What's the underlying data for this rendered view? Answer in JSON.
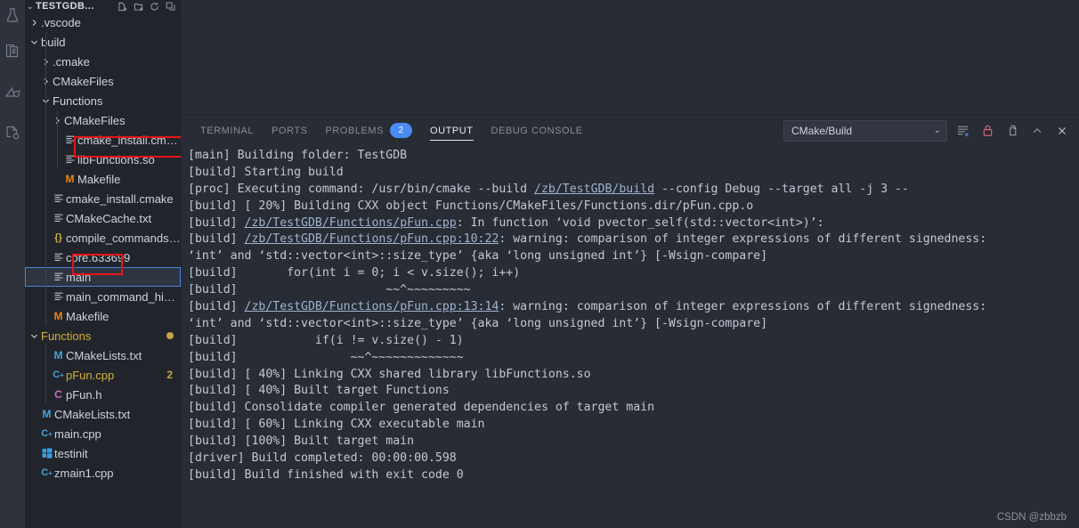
{
  "window": {
    "background": "#282c34",
    "sidebar_background": "#21252b",
    "accent": "#4b8bf5",
    "annotation_color": "#e81416"
  },
  "activity_bar": {
    "items": [
      {
        "name": "testing-beaker-icon"
      },
      {
        "name": "docs-notebook-icon"
      },
      {
        "name": "cmake-tools-icon"
      },
      {
        "name": "cpp-settings-icon"
      }
    ]
  },
  "explorer": {
    "root_label": "TESTGDB...",
    "chevron": "⌄",
    "actions": [
      {
        "name": "new-file-icon",
        "glyph": "⧉"
      },
      {
        "name": "new-folder-icon",
        "glyph": "⧉"
      },
      {
        "name": "refresh-icon",
        "glyph": "⟳"
      },
      {
        "name": "collapse-all-icon",
        "glyph": "⬚"
      }
    ],
    "tree": [
      {
        "label": ".vscode",
        "indent": 1,
        "twisty": "collapsed",
        "icon": "folder",
        "icon_color": "#c3c9d4"
      },
      {
        "label": "build",
        "indent": 1,
        "twisty": "expanded",
        "icon": "folder",
        "icon_color": "#c3c9d4"
      },
      {
        "label": ".cmake",
        "indent": 2,
        "twisty": "collapsed",
        "icon": "folder",
        "icon_color": "#c3c9d4"
      },
      {
        "label": "CMakeFiles",
        "indent": 2,
        "twisty": "collapsed",
        "icon": "folder",
        "icon_color": "#c3c9d4"
      },
      {
        "label": "Functions",
        "indent": 2,
        "twisty": "expanded",
        "icon": "folder",
        "icon_color": "#c3c9d4"
      },
      {
        "label": "CMakeFiles",
        "indent": 3,
        "twisty": "collapsed",
        "icon": "folder",
        "icon_color": "#c3c9d4"
      },
      {
        "label": "cmake_install.cmake",
        "indent": 3,
        "twisty": "none",
        "icon": "lines",
        "icon_color": "#b6bdc9"
      },
      {
        "label": "libFunctions.so",
        "indent": 3,
        "twisty": "none",
        "icon": "lines",
        "icon_color": "#b6bdc9",
        "annotated": true
      },
      {
        "label": "Makefile",
        "indent": 3,
        "twisty": "none",
        "icon": "M",
        "icon_color": "#e8821f"
      },
      {
        "label": "cmake_install.cmake",
        "indent": 2,
        "twisty": "none",
        "icon": "lines",
        "icon_color": "#b6bdc9"
      },
      {
        "label": "CMakeCache.txt",
        "indent": 2,
        "twisty": "none",
        "icon": "lines",
        "icon_color": "#b6bdc9"
      },
      {
        "label": "compile_commands.j...",
        "indent": 2,
        "twisty": "none",
        "icon": "{}",
        "icon_color": "#d3b03a"
      },
      {
        "label": "core.633699",
        "indent": 2,
        "twisty": "none",
        "icon": "lines",
        "icon_color": "#b6bdc9"
      },
      {
        "label": "main",
        "indent": 2,
        "twisty": "none",
        "icon": "lines",
        "icon_color": "#b6bdc9",
        "selected": true,
        "focused": true,
        "annotated": true
      },
      {
        "label": "main_command_hist...",
        "indent": 2,
        "twisty": "none",
        "icon": "lines",
        "icon_color": "#b6bdc9"
      },
      {
        "label": "Makefile",
        "indent": 2,
        "twisty": "none",
        "icon": "M",
        "icon_color": "#e8821f"
      },
      {
        "label": "Functions",
        "indent": 1,
        "twisty": "expanded",
        "icon": "folder",
        "icon_color": "#d3b03a",
        "label_color": "#d3b03a",
        "dot": true
      },
      {
        "label": "CMakeLists.txt",
        "indent": 2,
        "twisty": "none",
        "icon": "M",
        "icon_color": "#48a0d8"
      },
      {
        "label": "pFun.cpp",
        "indent": 2,
        "twisty": "none",
        "icon": "Cpp",
        "icon_color": "#48a0d8",
        "label_color": "#d3b03a",
        "badge": "2"
      },
      {
        "label": "pFun.h",
        "indent": 2,
        "twisty": "none",
        "icon": "C",
        "icon_color": "#d06ec4"
      },
      {
        "label": "CMakeLists.txt",
        "indent": 1,
        "twisty": "none",
        "icon": "M",
        "icon_color": "#48a0d8"
      },
      {
        "label": "main.cpp",
        "indent": 1,
        "twisty": "none",
        "icon": "Cpp",
        "icon_color": "#48a0d8"
      },
      {
        "label": "testinit",
        "indent": 1,
        "twisty": "none",
        "icon": "exe",
        "icon_color": "#3b9ddd"
      },
      {
        "label": "zmain1.cpp",
        "indent": 1,
        "twisty": "none",
        "icon": "Cpp",
        "icon_color": "#48a0d8"
      }
    ]
  },
  "panel": {
    "tabs": [
      {
        "label": "TERMINAL",
        "active": false
      },
      {
        "label": "PORTS",
        "active": false
      },
      {
        "label": "PROBLEMS",
        "active": false,
        "badge": "2"
      },
      {
        "label": "OUTPUT",
        "active": true
      },
      {
        "label": "DEBUG CONSOLE",
        "active": false
      }
    ],
    "output_channel": {
      "selected": "CMake/Build",
      "chevron": "⌄"
    },
    "actions": [
      {
        "name": "clear-output-icon"
      },
      {
        "name": "lock-icon"
      },
      {
        "name": "split-panel-icon"
      },
      {
        "name": "maximize-panel-icon"
      },
      {
        "name": "close-panel-icon"
      }
    ],
    "output_lines": [
      [
        {
          "t": "[main] Building folder: TestGDB"
        }
      ],
      [
        {
          "t": "[build] Starting build"
        }
      ],
      [
        {
          "t": "[proc] Executing command: /usr/bin/cmake --build "
        },
        {
          "t": "/zb/TestGDB/build",
          "link": true
        },
        {
          "t": " --config Debug --target all -j 3 --"
        }
      ],
      [
        {
          "t": "[build] [ 20%] Building CXX object Functions/CMakeFiles/Functions.dir/pFun.cpp.o"
        }
      ],
      [
        {
          "t": "[build] "
        },
        {
          "t": "/zb/TestGDB/Functions/pFun.cpp",
          "link": true
        },
        {
          "t": ": In function ‘void pvector_self(std::vector<int>)’:"
        }
      ],
      [
        {
          "t": "[build] "
        },
        {
          "t": "/zb/TestGDB/Functions/pFun.cpp:10:22",
          "link": true
        },
        {
          "t": ": warning: comparison of integer expressions of different signedness:"
        }
      ],
      [
        {
          "t": "‘int’ and ‘std::vector<int>::size_type’ {aka ‘long unsigned int’} [-Wsign-compare]"
        }
      ],
      [
        {
          "t": "[build]       for(int i = 0; i < v.size(); i++)"
        }
      ],
      [
        {
          "t": "[build]                     ~~^~~~~~~~~~"
        }
      ],
      [
        {
          "t": "[build] "
        },
        {
          "t": "/zb/TestGDB/Functions/pFun.cpp:13:14",
          "link": true
        },
        {
          "t": ": warning: comparison of integer expressions of different signedness:"
        }
      ],
      [
        {
          "t": "‘int’ and ‘std::vector<int>::size_type’ {aka ‘long unsigned int’} [-Wsign-compare]"
        }
      ],
      [
        {
          "t": "[build]           if(i != v.size() - 1)"
        }
      ],
      [
        {
          "t": "[build]                ~~^~~~~~~~~~~~~~"
        }
      ],
      [
        {
          "t": "[build] [ 40%] Linking CXX shared library libFunctions.so"
        }
      ],
      [
        {
          "t": "[build] [ 40%] Built target Functions"
        }
      ],
      [
        {
          "t": "[build] Consolidate compiler generated dependencies of target main"
        }
      ],
      [
        {
          "t": "[build] [ 60%] Linking CXX executable main"
        }
      ],
      [
        {
          "t": "[build] [100%] Built target main"
        }
      ],
      [
        {
          "t": "[driver] Build completed: 00:00:00.598"
        }
      ],
      [
        {
          "t": "[build] Build finished with exit code 0"
        }
      ]
    ]
  },
  "watermark": "CSDN @zbbzb"
}
